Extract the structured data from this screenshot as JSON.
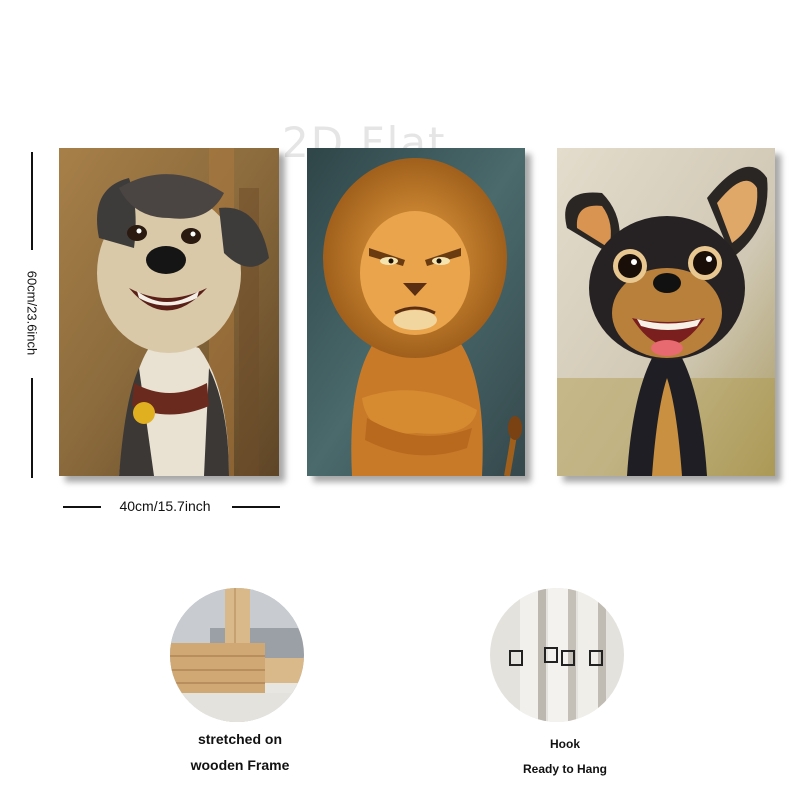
{
  "watermark": "2D Flat",
  "dimensions": {
    "height_label": "60cm/23.6inch",
    "width_label": "40cm/15.7inch"
  },
  "paintings": [
    {
      "subject": "terrier dog with collar",
      "icon": "dog-painting"
    },
    {
      "subject": "grumpy lion with crossed arms",
      "icon": "lion-painting"
    },
    {
      "subject": "excited chihuahua",
      "icon": "chihuahua-painting"
    }
  ],
  "features": [
    {
      "line1": "stretched on",
      "line2": "wooden Frame",
      "icon": "wooden-frame-photo"
    },
    {
      "line1": "Hook",
      "line2": "Ready to Hang",
      "icon": "hook-photo"
    }
  ],
  "colors": {
    "dog_bg": "#8a6a3c",
    "lion_bg": "#3f5a5e",
    "chihuahua_bg": "#d8d2c2",
    "wood": "#d9b98a"
  }
}
